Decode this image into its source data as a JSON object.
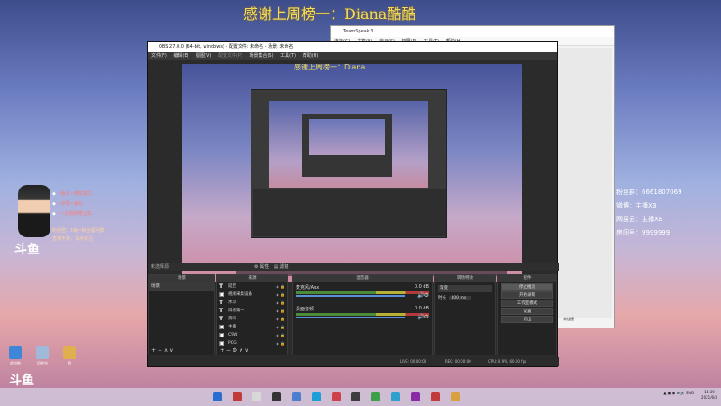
{
  "banner": "感谢上周榜一：Diana酷酷",
  "inner_banner": "感谢上周榜一：Diana",
  "left_overlay": {
    "lines": [
      "~鱼丸~老铁关注",
      "~点赞~鱼丸",
      "~~找我玩带上车"
    ],
    "footer": [
      "粉丝团：1级~粉丝福利群",
      "直播不易，请点关注"
    ],
    "logo": "斗鱼"
  },
  "right_overlay": [
    {
      "icon": "fans-icon",
      "text": "粉丝群：6661807069"
    },
    {
      "icon": "weibo-icon",
      "text": "微博：主播XB"
    },
    {
      "icon": "netease-icon",
      "text": "网易云：主播XB"
    },
    {
      "icon": "room-icon",
      "text": "房间号：9999999"
    }
  ],
  "desktop_icons": [
    {
      "label": "此电脑",
      "color": "#3d86d8"
    },
    {
      "label": "回收站",
      "color": "#9fbad8"
    },
    {
      "label": "图",
      "color": "#e0b050"
    }
  ],
  "teamspeak": {
    "title": "TeamSpeak 3",
    "menu": [
      "连接(C)",
      "书签(B)",
      "自己(S)",
      "权限(P)",
      "工具(T)",
      "帮助(H)"
    ],
    "status": "未连接"
  },
  "obs": {
    "title": "OBS 27.0.0 (64-bit, windows) - 配置文件: 未命名 - 场景: 未命名",
    "menu": [
      "文件(F)",
      "编辑(E)",
      "视图(V)",
      "配置文件(P)",
      "场景集合(S)",
      "工具(T)",
      "帮助(H)"
    ],
    "scene_bar_label": "未选择源",
    "filters": [
      "属性",
      "滤镜"
    ],
    "panels": {
      "scenes": {
        "title": "场景",
        "items": [
          "场景"
        ]
      },
      "sources": {
        "title": "来源",
        "items": [
          {
            "icon": "T",
            "name": "延迟"
          },
          {
            "icon": "▣",
            "name": "视频采集设备"
          },
          {
            "icon": "T",
            "name": "水印"
          },
          {
            "icon": "T",
            "name": "周榜第一"
          },
          {
            "icon": "T",
            "name": "资料"
          },
          {
            "icon": "▣",
            "name": "主播"
          },
          {
            "icon": "▣",
            "name": "CSW"
          },
          {
            "icon": "▣",
            "name": "POG"
          }
        ]
      },
      "mixer": {
        "title": "混音器",
        "channels": [
          {
            "name": "麦克风/Aux",
            "level": "0.0 dB"
          },
          {
            "name": "桌面音频",
            "level": "0.0 dB"
          }
        ]
      },
      "transitions": {
        "title": "转场特效",
        "type": "渐变",
        "duration_label": "时长",
        "duration": "300 ms"
      },
      "controls": {
        "title": "控件",
        "buttons": [
          "停止推流",
          "开始录制",
          "工作室模式",
          "设置",
          "退出"
        ]
      }
    },
    "status": {
      "live": "LIVE: 00:00:00",
      "rec": "REC: 00:00:00",
      "cpu": "CPU: 0.9%, 60.00 fps"
    }
  },
  "taskbar": {
    "icons": [
      "#2a6fd0",
      "#c23b3b",
      "#d8d8d8",
      "#333",
      "#4c7fd0",
      "#1c9fd8",
      "#d0404a",
      "#3d3d3d",
      "#3fa04a",
      "#2f9fd0",
      "#8a2aa6",
      "#c23b3b",
      "#d8a040"
    ],
    "tray_text": "ENG",
    "time": "14:39",
    "date": "2021/6/4"
  }
}
